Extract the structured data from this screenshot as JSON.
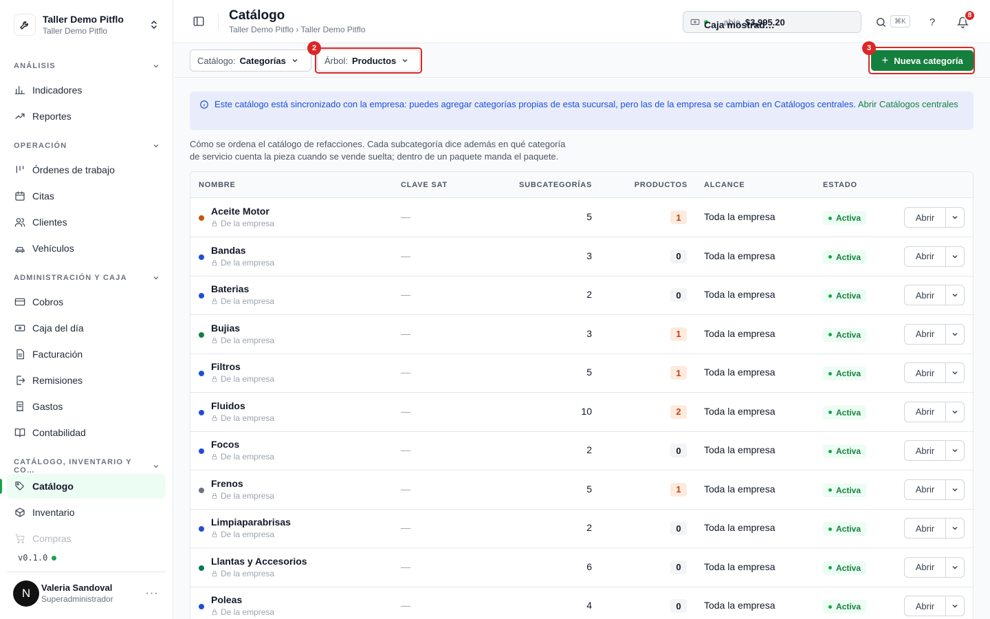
{
  "org": {
    "name": "Taller Demo Pitflo",
    "sub": "Taller Demo Pitflo"
  },
  "sidebar": {
    "sections": [
      {
        "label": "ANÁLISIS",
        "items": [
          {
            "label": "Indicadores",
            "icon": "bar-chart-icon"
          },
          {
            "label": "Reportes",
            "icon": "trend-icon"
          }
        ]
      },
      {
        "label": "OPERACIÓN",
        "items": [
          {
            "label": "Órdenes de trabajo",
            "icon": "kanban-icon"
          },
          {
            "label": "Citas",
            "icon": "calendar-icon"
          },
          {
            "label": "Clientes",
            "icon": "users-icon"
          },
          {
            "label": "Vehículos",
            "icon": "car-icon"
          }
        ]
      },
      {
        "label": "ADMINISTRACIÓN Y CAJA",
        "items": [
          {
            "label": "Cobros",
            "icon": "card-icon"
          },
          {
            "label": "Caja del día",
            "icon": "cash-icon"
          },
          {
            "label": "Facturación",
            "icon": "invoice-icon"
          },
          {
            "label": "Remisiones",
            "icon": "export-icon"
          },
          {
            "label": "Gastos",
            "icon": "receipt-icon"
          },
          {
            "label": "Contabilidad",
            "icon": "book-icon"
          }
        ]
      },
      {
        "label": "CATÁLOGO, INVENTARIO Y CO…",
        "items": [
          {
            "label": "Catálogo",
            "icon": "tag-icon",
            "active": true
          },
          {
            "label": "Inventario",
            "icon": "box-icon"
          },
          {
            "label": "Compras",
            "icon": "cart-icon"
          }
        ]
      }
    ],
    "version": "v0.1.0",
    "user": {
      "initial": "N",
      "name": "Valeria Sandoval",
      "role": "Superadministrador",
      "more": "···"
    }
  },
  "header": {
    "title": "Catálogo",
    "breadcrumb": "Taller Demo Pitflo › Taller Demo Pitflo",
    "cash": {
      "name": "Caja mostrad…",
      "sep": "·",
      "state": "abie",
      "amount": "$3,995.20"
    },
    "shortcut": "⌘K",
    "help": "?",
    "notifications": "8"
  },
  "toolbar": {
    "catalog_label": "Catálogo:",
    "catalog_value": "Categorías",
    "tree_label": "Árbol:",
    "tree_value": "Productos",
    "new_label": "Nueva categoría",
    "step2": "2",
    "step3": "3"
  },
  "banner": {
    "text": "Este catálogo está sincronizado con la empresa: puedes agregar categorías propias de esta sucursal, pero las de la empresa se cambian en Catálogos centrales.",
    "link": "Abrir Catálogos centrales"
  },
  "description": {
    "line1": "Cómo se ordena el catálogo de refacciones. Cada subcategoría dice además en qué categoría",
    "line2": "de servicio cuenta la pieza cuando se vende suelta; dentro de un paquete manda el paquete."
  },
  "table": {
    "headers": {
      "name": "NOMBRE",
      "sat": "CLAVE SAT",
      "sub": "SUBCATEGORÍAS",
      "prod": "PRODUCTOS",
      "scope": "ALCANCE",
      "status": "ESTADO"
    },
    "rows": [
      {
        "name": "Aceite Motor",
        "origin": "De la empresa",
        "sat": "—",
        "sub": "5",
        "prod": "1",
        "scope": "Toda la empresa",
        "status": "Activa",
        "color": "#c2570c",
        "action": "Abrir"
      },
      {
        "name": "Bandas",
        "origin": "De la empresa",
        "sat": "—",
        "sub": "3",
        "prod": "0",
        "scope": "Toda la empresa",
        "status": "Activa",
        "color": "#1d4ed8",
        "action": "Abrir"
      },
      {
        "name": "Baterias",
        "origin": "De la empresa",
        "sat": "—",
        "sub": "2",
        "prod": "0",
        "scope": "Toda la empresa",
        "status": "Activa",
        "color": "#1d4ed8",
        "action": "Abrir"
      },
      {
        "name": "Bujias",
        "origin": "De la empresa",
        "sat": "—",
        "sub": "3",
        "prod": "1",
        "scope": "Toda la empresa",
        "status": "Activa",
        "color": "#15803d",
        "action": "Abrir"
      },
      {
        "name": "Filtros",
        "origin": "De la empresa",
        "sat": "—",
        "sub": "5",
        "prod": "1",
        "scope": "Toda la empresa",
        "status": "Activa",
        "color": "#1d4ed8",
        "action": "Abrir"
      },
      {
        "name": "Fluidos",
        "origin": "De la empresa",
        "sat": "—",
        "sub": "10",
        "prod": "2",
        "scope": "Toda la empresa",
        "status": "Activa",
        "color": "#1d4ed8",
        "action": "Abrir"
      },
      {
        "name": "Focos",
        "origin": "De la empresa",
        "sat": "—",
        "sub": "2",
        "prod": "0",
        "scope": "Toda la empresa",
        "status": "Activa",
        "color": "#1d4ed8",
        "action": "Abrir"
      },
      {
        "name": "Frenos",
        "origin": "De la empresa",
        "sat": "—",
        "sub": "5",
        "prod": "1",
        "scope": "Toda la empresa",
        "status": "Activa",
        "color": "#6b7280",
        "action": "Abrir"
      },
      {
        "name": "Limpiaparabrisas",
        "origin": "De la empresa",
        "sat": "—",
        "sub": "2",
        "prod": "0",
        "scope": "Toda la empresa",
        "status": "Activa",
        "color": "#1d4ed8",
        "action": "Abrir"
      },
      {
        "name": "Llantas y Accesorios",
        "origin": "De la empresa",
        "sat": "—",
        "sub": "6",
        "prod": "0",
        "scope": "Toda la empresa",
        "status": "Activa",
        "color": "#047857",
        "action": "Abrir"
      },
      {
        "name": "Poleas",
        "origin": "De la empresa",
        "sat": "—",
        "sub": "4",
        "prod": "0",
        "scope": "Toda la empresa",
        "status": "Activa",
        "color": "#1d4ed8",
        "action": "Abrir"
      }
    ]
  }
}
